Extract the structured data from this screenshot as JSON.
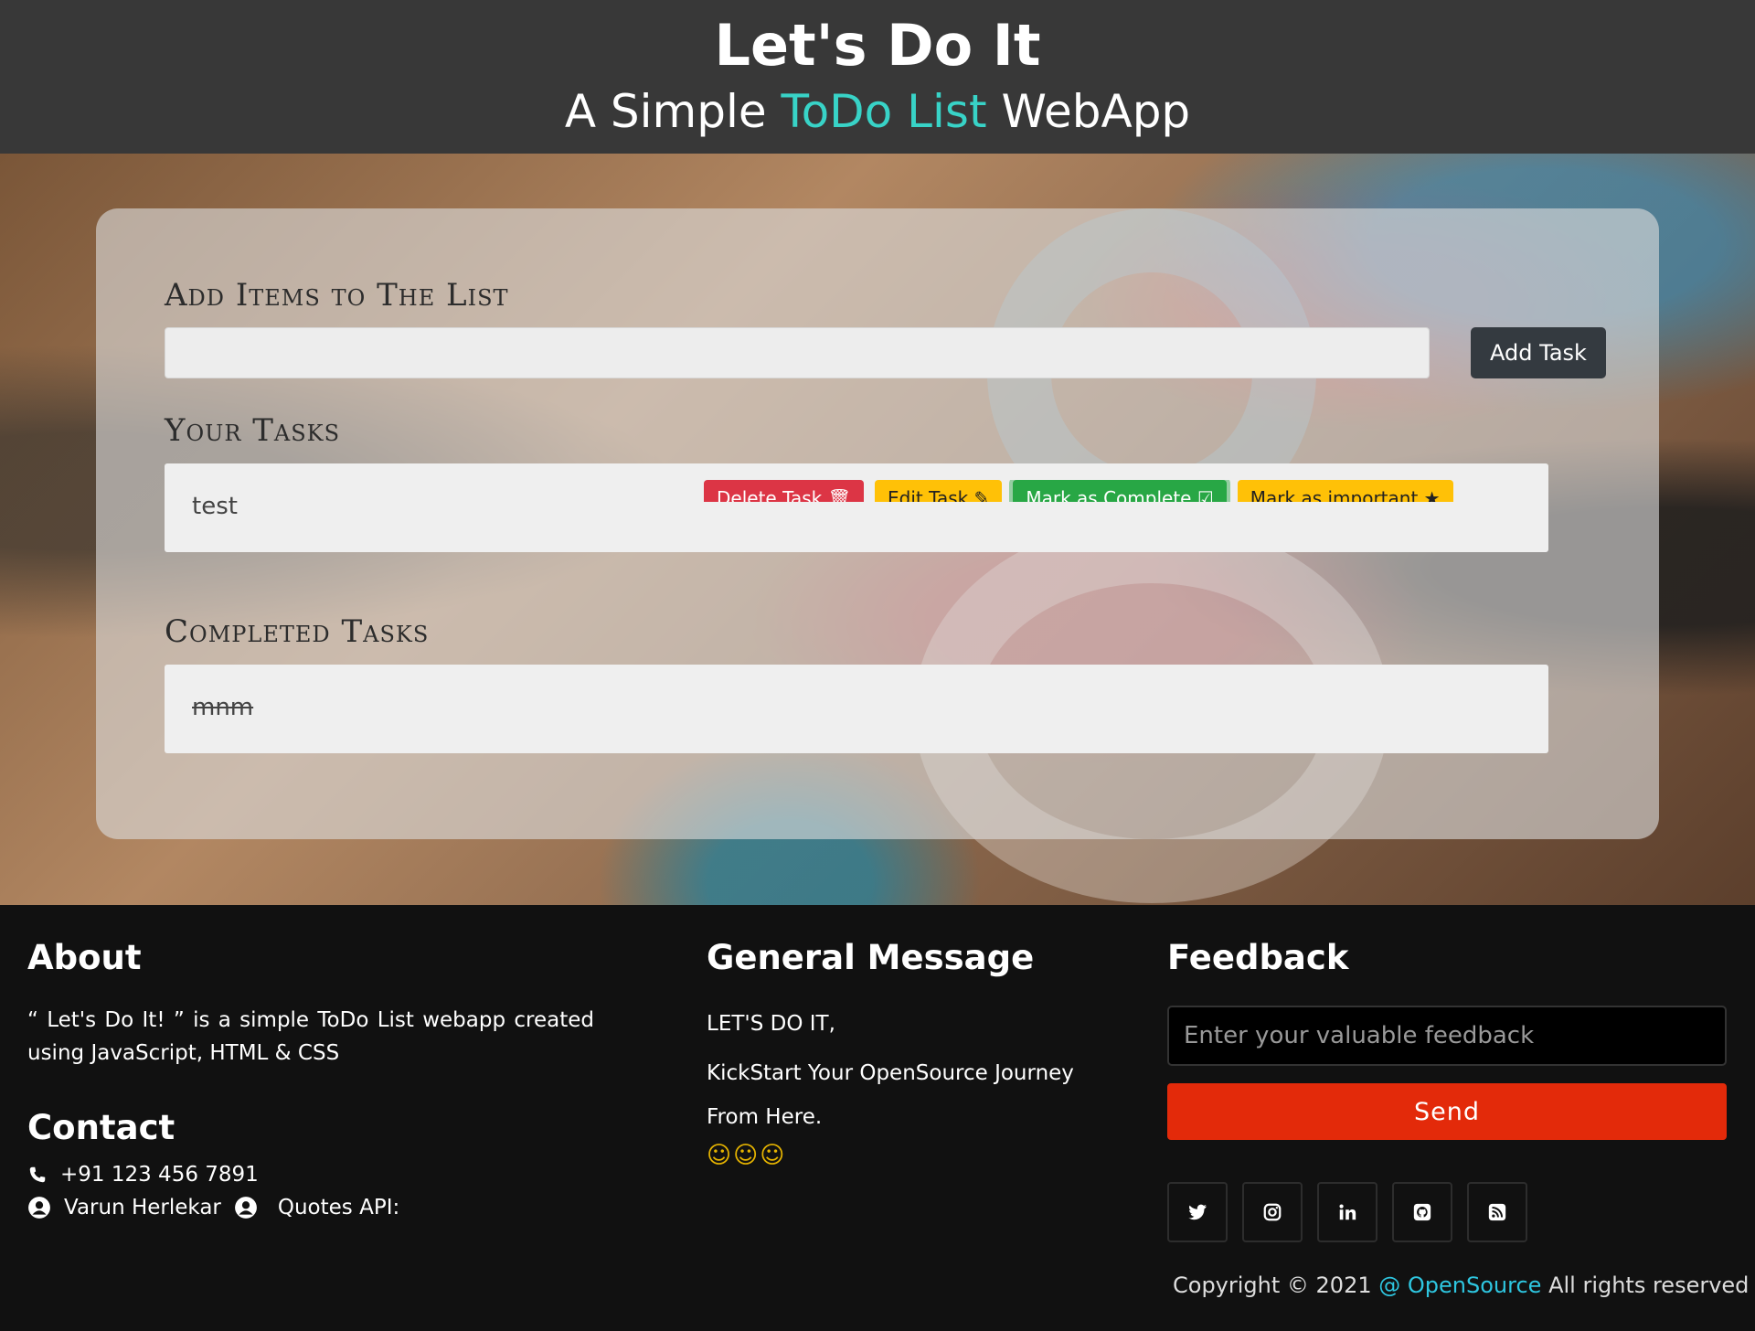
{
  "header": {
    "title": "Let's Do It",
    "subtitle_pre": "A Simple",
    "subtitle_accent": "ToDo List",
    "subtitle_post": "WebApp"
  },
  "add_section": {
    "title": "Add Items to The List",
    "input_value": "",
    "button_label": "Add Task"
  },
  "tasks_section": {
    "title": "Your Tasks",
    "tasks": [
      {
        "text": "test",
        "actions": [
          "Delete Task",
          "Edit Task",
          "Mark as Complete",
          "Mark as important"
        ]
      }
    ]
  },
  "completed_section": {
    "title": "Completed Tasks",
    "tasks": [
      {
        "text": "mnm"
      }
    ]
  },
  "footer": {
    "about": {
      "title": "About",
      "text": "“ Let's Do It! ” is a simple ToDo List webapp created using JavaScript, HTML & CSS"
    },
    "contact": {
      "title": "Contact",
      "phone": "+91 123 456 7891",
      "author": "Varun Herlekar",
      "quotes_label": "Quotes API:"
    },
    "general": {
      "title": "General Message",
      "line1": "LET'S DO IT,",
      "line2": "KickStart Your OpenSource Journey From Here.",
      "emojis": "☺☺☺"
    },
    "feedback": {
      "title": "Feedback",
      "placeholder": "Enter your valuable feedback",
      "send_label": "Send",
      "socials": [
        "twitter-icon",
        "instagram-icon",
        "linkedin-icon",
        "github-icon",
        "rss-icon"
      ]
    },
    "copyright": {
      "pre": "Copyright © 2021",
      "link": "@ OpenSource",
      "post": "All rights reserved"
    }
  },
  "colors": {
    "accent": "#38d3c7",
    "send": "#e32a0a",
    "link": "#2ec6e0"
  }
}
